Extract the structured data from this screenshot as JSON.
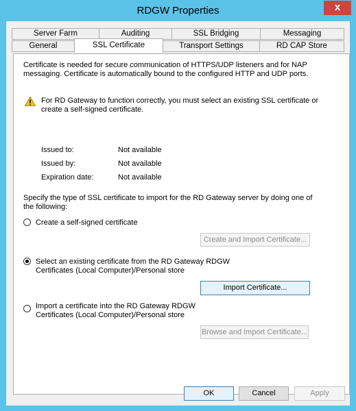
{
  "window": {
    "title": "RDGW Properties",
    "close_glyph": "x"
  },
  "tabs": {
    "row1": [
      "Server Farm",
      "Auditing",
      "SSL Bridging",
      "Messaging"
    ],
    "row2": [
      "General",
      "SSL Certificate",
      "Transport Settings",
      "RD CAP Store"
    ],
    "active": "SSL Certificate"
  },
  "intro": {
    "line1": "Certificate is needed for secure communication of HTTPS/UDP listeners and for NAP",
    "line2": "messaging. Certificate is automatically bound to the configured HTTP and UDP ports."
  },
  "warning": {
    "icon": "warning-icon",
    "line1": "For RD Gateway to function correctly, you must select an existing SSL certificate or",
    "line2": "create a self-signed certificate."
  },
  "cert_info": {
    "issued_to_label": "Issued to:",
    "issued_to_value": "Not available",
    "issued_by_label": "Issued by:",
    "issued_by_value": "Not available",
    "expiration_label": "Expiration date:",
    "expiration_value": "Not available"
  },
  "specify": {
    "line1": "Specify the type of SSL certificate to import for the RD Gateway server by doing one of",
    "line2": "the following:"
  },
  "options": {
    "self_signed": {
      "label": "Create a self-signed certificate",
      "checked": false,
      "button": "Create and Import Certificate..."
    },
    "existing": {
      "line1": "Select an existing certificate from the RD Gateway RDGW",
      "line2": "Certificates (Local Computer)/Personal store",
      "checked": true,
      "button": "Import Certificate..."
    },
    "import": {
      "line1": "Import a certificate into the RD Gateway RDGW",
      "line2": "Certificates (Local Computer)/Personal store",
      "checked": false,
      "button": "Browse and Import Certificate..."
    }
  },
  "footer": {
    "ok": "OK",
    "cancel": "Cancel",
    "apply": "Apply"
  }
}
